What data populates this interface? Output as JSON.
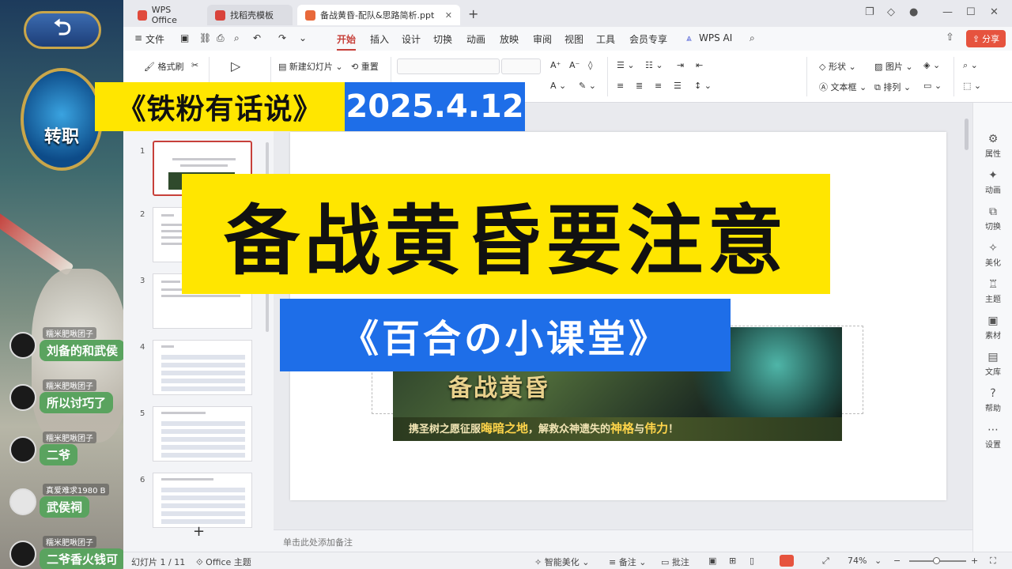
{
  "stream": {
    "back_icon": "back-arrow-icon",
    "job_badge_text": "转职",
    "chat": [
      {
        "user": "糯米肥啾团子",
        "text": "刘备的和武侯"
      },
      {
        "user": "糯米肥啾团子",
        "text": "所以讨巧了"
      },
      {
        "user": "糯米肥啾团子",
        "text": "二爷"
      },
      {
        "user": "真爱难求1980 B",
        "text": "武侯祠"
      },
      {
        "user": "糯米肥啾团子",
        "text": "二爷香火钱可"
      }
    ]
  },
  "titlebar": {
    "tabs": [
      {
        "label": "WPS Office",
        "color": "#e04a3c"
      },
      {
        "label": "找稻壳模板",
        "color": "#d9433b"
      },
      {
        "label": "备战黄昏-配队&思路简析.ppt",
        "color": "#e8683a"
      }
    ],
    "new_tab": "+"
  },
  "menu": {
    "file": "文件",
    "items": [
      "开始",
      "插入",
      "设计",
      "切换",
      "动画",
      "放映",
      "审阅",
      "视图",
      "工具",
      "会员专享"
    ],
    "active": "开始",
    "ai": "WPS AI",
    "share": "分享"
  },
  "ribbon": {
    "format_painter": "格式刷",
    "new_slide": "新建幻灯片",
    "reset": "重置",
    "shape": "形状",
    "picture": "图片",
    "textbox": "文本框",
    "arrange": "排列"
  },
  "thumbnails": [
    {
      "num": "1"
    },
    {
      "num": "2"
    },
    {
      "num": "3"
    },
    {
      "num": "4"
    },
    {
      "num": "5"
    },
    {
      "num": "6"
    }
  ],
  "slide": {
    "banner_logo": "备战黄昏",
    "banner_strip_a": "携圣树之愿征服",
    "banner_strip_b": "晦暗之地",
    "banner_strip_c": "，解救众神遗失的",
    "banner_strip_d": "神格",
    "banner_strip_e": "与",
    "banner_strip_f": "伟力",
    "banner_strip_g": "！"
  },
  "notes_placeholder": "单击此处添加备注",
  "statusbar": {
    "slide_counter": "幻灯片 1 / 11",
    "theme": "Office 主题",
    "beautify": "智能美化",
    "notes": "备注",
    "comment": "批注",
    "zoom": "74%"
  },
  "sidebar": [
    "属性",
    "动画",
    "切换",
    "美化",
    "主题",
    "素材",
    "文库",
    "帮助",
    "设置"
  ],
  "overlays": {
    "series": "《铁粉有话说》",
    "date": "2025.4.12",
    "headline": "备战黄昏要注意",
    "course": "《百合の小课堂》"
  }
}
